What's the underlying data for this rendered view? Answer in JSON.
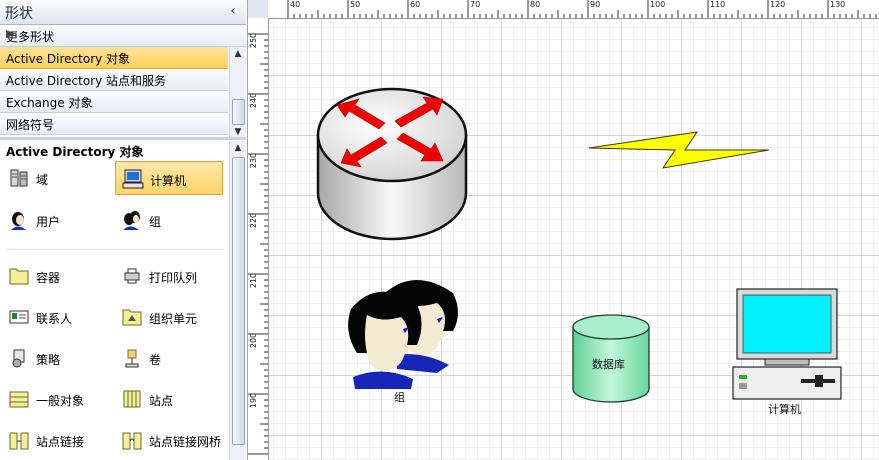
{
  "shapes_pane": {
    "title": "形状",
    "more_shapes": "更多形状",
    "stencils": [
      {
        "label": "Active Directory 对象",
        "selected": true
      },
      {
        "label": "Active Directory 站点和服务",
        "selected": false
      },
      {
        "label": "Exchange 对象",
        "selected": false
      },
      {
        "label": "网络符号",
        "selected": false
      }
    ],
    "heading": "Active Directory 对象",
    "items": [
      {
        "label": "域",
        "icon": "domain-icon"
      },
      {
        "label": "计算机",
        "icon": "computer-icon",
        "selected": true
      },
      {
        "label": "用户",
        "icon": "user-icon"
      },
      {
        "label": "组",
        "icon": "group-icon"
      },
      {
        "label": "容器",
        "icon": "container-icon"
      },
      {
        "label": "打印队列",
        "icon": "print-queue-icon"
      },
      {
        "label": "联系人",
        "icon": "contact-icon"
      },
      {
        "label": "组织单元",
        "icon": "organizational-unit-icon"
      },
      {
        "label": "策略",
        "icon": "policy-icon"
      },
      {
        "label": "卷",
        "icon": "volume-icon"
      },
      {
        "label": "一般对象",
        "icon": "generic-object-icon"
      },
      {
        "label": "站点",
        "icon": "site-icon"
      },
      {
        "label": "站点链接",
        "icon": "site-link-icon"
      },
      {
        "label": "站点链接网桥",
        "icon": "site-link-bridge-icon"
      }
    ]
  },
  "rulers": {
    "horizontal": [
      "40",
      "50",
      "60",
      "70",
      "80",
      "90",
      "100",
      "110",
      "120",
      "130"
    ],
    "vertical": [
      "250",
      "240",
      "230",
      "220",
      "210",
      "200",
      "190"
    ]
  },
  "canvas": {
    "group_caption": "组",
    "database_caption": "数据库",
    "computer_caption": "计算机"
  },
  "colors": {
    "selection": "#ffd46a",
    "router_arrow": "#e00000",
    "lightning": "#ffff00",
    "database": "#88e6b4",
    "screen": "#00e8ff"
  }
}
